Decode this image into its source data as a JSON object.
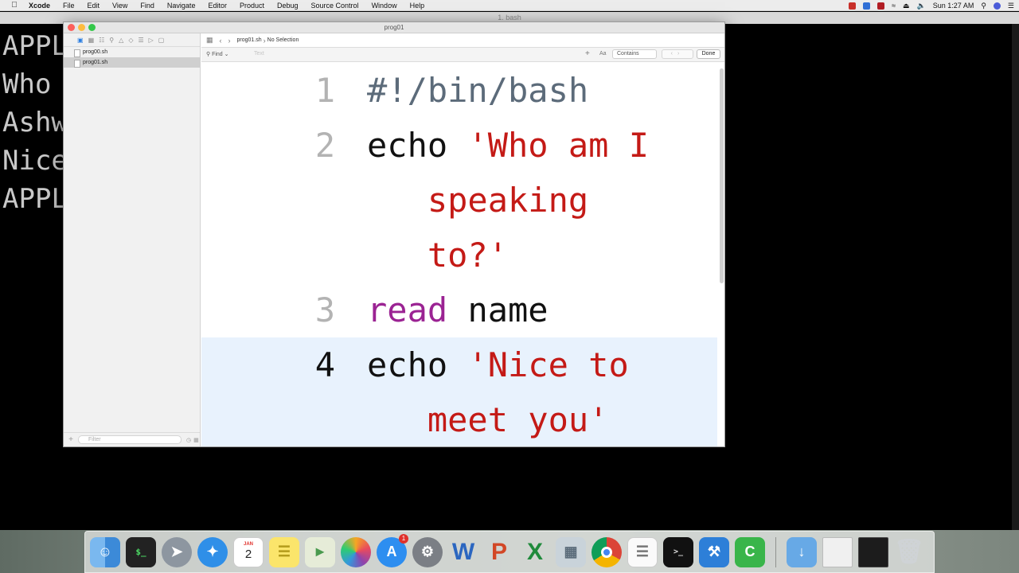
{
  "menubar": {
    "apple_icon": "apple-logo",
    "items": [
      "Xcode",
      "File",
      "Edit",
      "View",
      "Find",
      "Navigate",
      "Editor",
      "Product",
      "Debug",
      "Source Control",
      "Window",
      "Help"
    ],
    "clock": "Sun 1:27 AM",
    "status_icons": [
      "red-app-icon",
      "dropbox-icon",
      "mcafee-icon",
      "wifi-icon",
      "eject-icon",
      "volume-icon"
    ]
  },
  "terminal": {
    "title": "1. bash",
    "lines": [
      "APPL",
      "Who",
      "Ashw",
      "Nice",
      "APPL"
    ]
  },
  "xcode": {
    "window_title": "prog01",
    "navigator": {
      "files": [
        "prog00.sh",
        "prog01.sh"
      ],
      "selected": "prog01.sh",
      "filter_placeholder": "Filter"
    },
    "jumpbar": {
      "file": "prog01.sh",
      "selection": "No Selection"
    },
    "find": {
      "mode": "Find",
      "placeholder": "Text",
      "match_case": "Aa",
      "match_type": "Contains",
      "done": "Done"
    },
    "code": [
      {
        "line": "1",
        "parts": [
          {
            "text": "#!/bin/bash",
            "kind": "shebang"
          }
        ]
      },
      {
        "line": "2",
        "parts": [
          {
            "text": "echo ",
            "kind": "plain"
          },
          {
            "text": "'Who am I\n   speaking\n   to?'",
            "kind": "str"
          }
        ]
      },
      {
        "line": "3",
        "parts": [
          {
            "text": "read",
            "kind": "kw"
          },
          {
            "text": " name",
            "kind": "plain"
          }
        ]
      },
      {
        "line": "4",
        "parts": [
          {
            "text": "echo ",
            "kind": "plain"
          },
          {
            "text": "'Nice to\n   meet you'",
            "kind": "str"
          }
        ]
      }
    ],
    "active_line": "4"
  },
  "dock": {
    "apps": [
      "finder-icon",
      "terminal-icon",
      "launchpad-icon",
      "safari-icon",
      "calendar-icon",
      "notes-icon",
      "maps-icon",
      "photos-icon",
      "app-store-icon",
      "system-preferences-icon",
      "word-icon",
      "powerpoint-icon",
      "excel-icon",
      "preview-icon",
      "chrome-icon",
      "textedit-icon",
      "terminal-window-icon",
      "xcode-icon",
      "camtasia-icon"
    ],
    "calendar_month": "JAN",
    "calendar_day": "2",
    "app_store_badge": "1",
    "trailing": [
      "downloads-folder-icon",
      "window-thumbnail-icon",
      "window-thumbnail-icon",
      "trash-icon"
    ]
  }
}
